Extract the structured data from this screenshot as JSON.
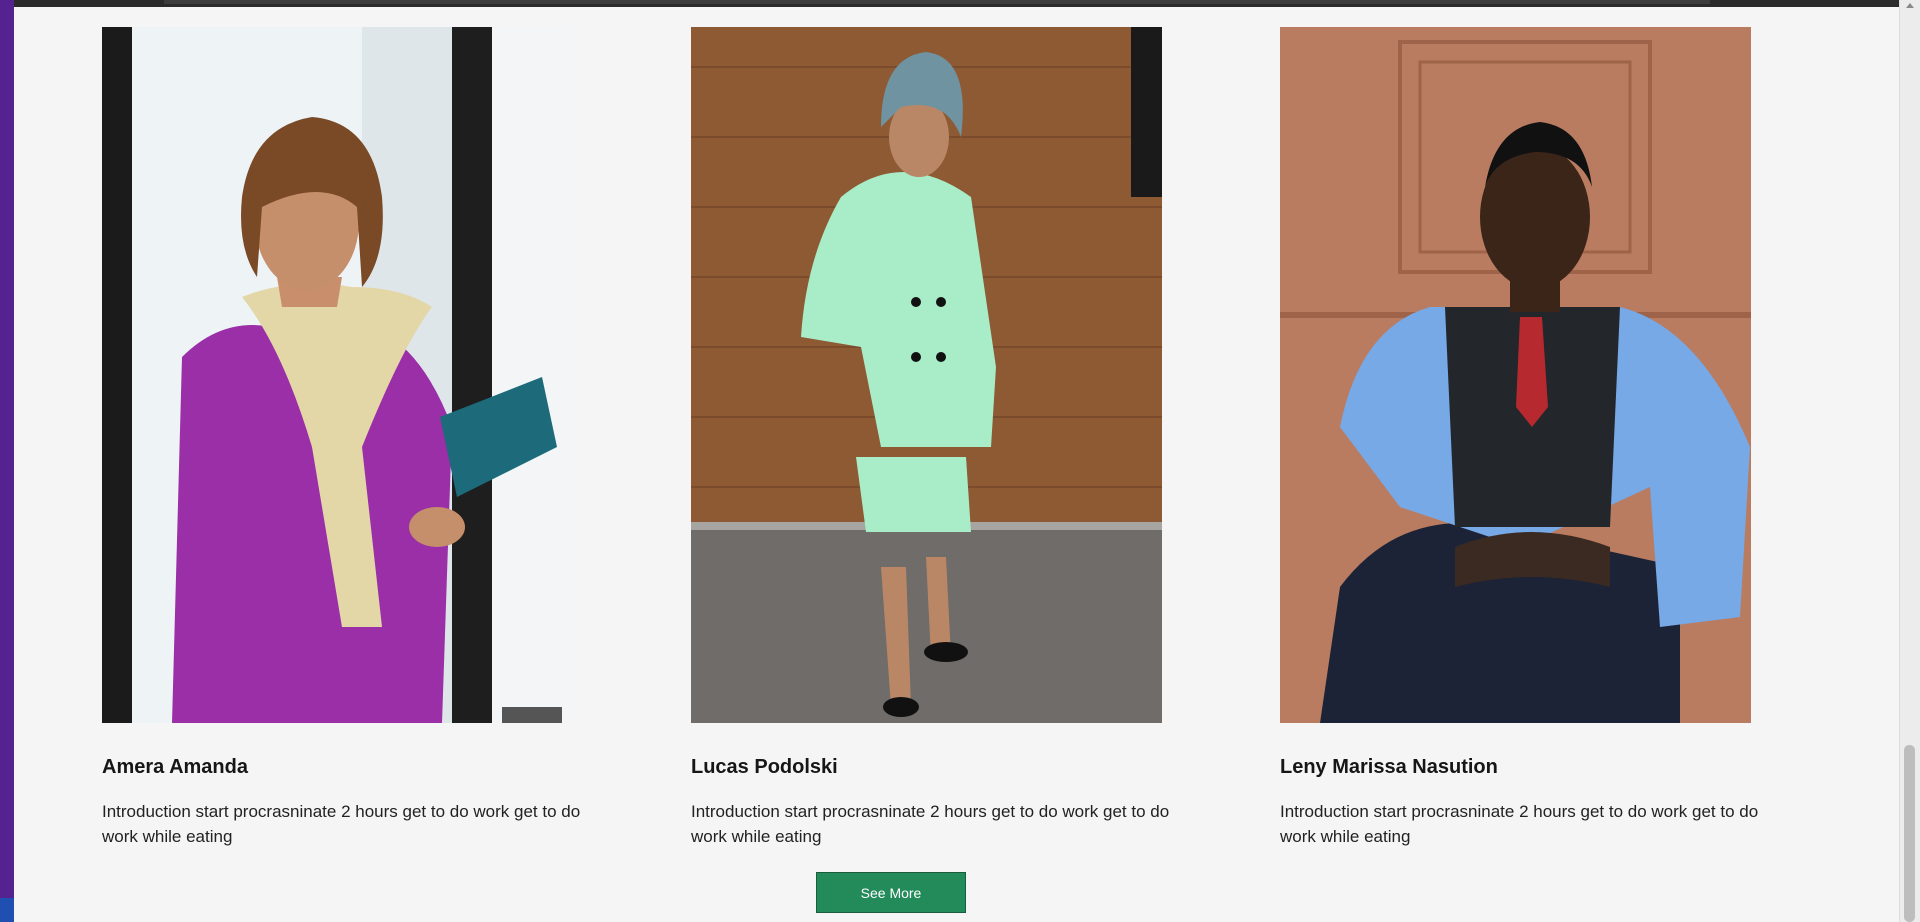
{
  "team": {
    "members": [
      {
        "name": "Amera Amanda",
        "description": "Introduction start procrasninate 2 hours get to do work get to do work while eating",
        "photo_icon": "woman-portrait-photo"
      },
      {
        "name": "Lucas Podolski",
        "description": "Introduction start procrasninate 2 hours get to do work get to do work while eating",
        "photo_icon": "woman-portrait-photo"
      },
      {
        "name": "Leny Marissa Nasution",
        "description": "Introduction start procrasninate 2 hours get to do work get to do work while eating",
        "photo_icon": "man-portrait-photo"
      }
    ],
    "see_more_label": "See More"
  },
  "colors": {
    "page_background": "#f5f5f5",
    "button_background": "#238a5a",
    "left_edge": "#55238f"
  }
}
